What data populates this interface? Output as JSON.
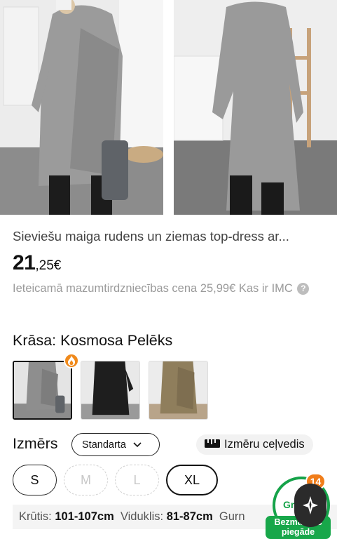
{
  "product": {
    "title": "Sieviešu maiga rudens un ziemas top-dress ar...",
    "price_main": "21",
    "price_fraction": ",25€",
    "rrp_text": "Ieteicamā mazumtirdzniecības cena 25,99€ Kas ir IMC",
    "help_icon": "?"
  },
  "color": {
    "label": "Krāsa: Kosmosa Pelēks",
    "swatches": [
      {
        "name": "Kosmosa Pelēks",
        "color": "#8e8e8e"
      },
      {
        "name": "Melns",
        "color": "#1e1e1e"
      },
      {
        "name": "Haki",
        "color": "#8f7e5c"
      }
    ],
    "selected_index": 0,
    "hot_icon": "fire-icon"
  },
  "size": {
    "label": "Izmērs",
    "standard_select": "Standarta",
    "guide_label": "Izmēru ceļvedis",
    "options": [
      {
        "label": "S",
        "state": "available"
      },
      {
        "label": "M",
        "state": "unavailable"
      },
      {
        "label": "L",
        "state": "unavailable"
      },
      {
        "label": "XL",
        "state": "selected"
      }
    ],
    "measurements": {
      "chest_label": "Krūtis:",
      "chest_value": "101-107cm",
      "waist_label": "Viduklis:",
      "waist_value": "81-87cm",
      "hip_label": "Gurn"
    }
  },
  "promo": {
    "cart_count": "14",
    "ring_text": "Gr",
    "ship_text": "Bezmaksas piegāde"
  },
  "colors": {
    "green": "#16a34a",
    "orange": "#f07d1a",
    "dark": "#111111"
  }
}
